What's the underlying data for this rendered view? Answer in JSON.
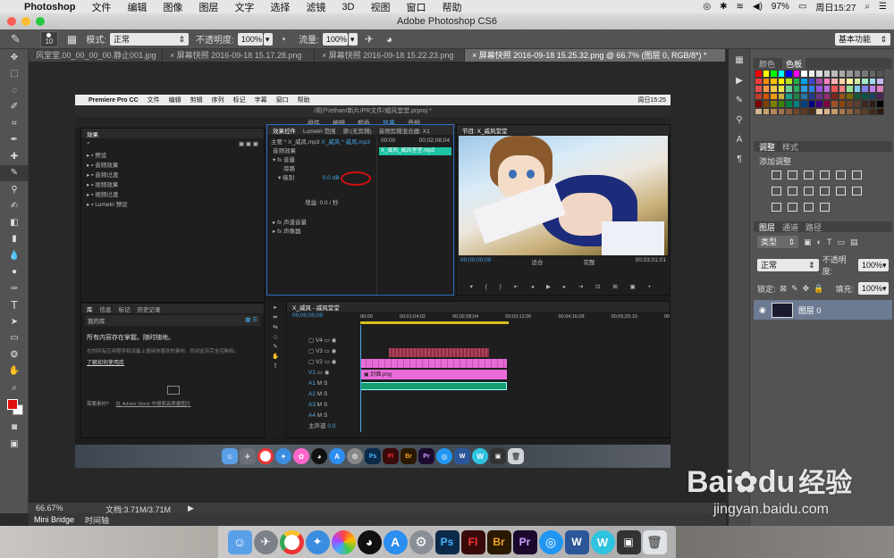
{
  "menubar": {
    "apple": "",
    "app": "Photoshop",
    "items": [
      "文件",
      "编辑",
      "图像",
      "图层",
      "文字",
      "选择",
      "滤镜",
      "3D",
      "视图",
      "窗口",
      "帮助"
    ],
    "battery": "97%",
    "clock": "周日15:27"
  },
  "window": {
    "title": "Adobe Photoshop CS6"
  },
  "options": {
    "brush_size": "10",
    "mode_label": "模式:",
    "mode_value": "正常",
    "opacity_label": "不透明度:",
    "opacity_value": "100%",
    "flow_label": "流量:",
    "flow_value": "100%",
    "workspace": "基本功能"
  },
  "tabs": [
    {
      "label": "风堂堂.00_00_00_00.静止001.jpg",
      "active": false
    },
    {
      "label": "屏幕快照 2016-09-18 15.17.28.png",
      "active": false
    },
    {
      "label": "屏幕快照 2016-09-18 15.22.23.png",
      "active": false
    },
    {
      "label": "屏幕快照 2016-09-18 15.25.32.png @ 66.7% (图层 0, RGB/8*) *",
      "active": true
    }
  ],
  "status": {
    "zoom": "66.67%",
    "doc": "文档:3.71M/3.71M"
  },
  "bottom_tabs": [
    "Mini Bridge",
    "时间轴"
  ],
  "premiere": {
    "app": "Premiere Pro CC",
    "menu": [
      "文件",
      "编辑",
      "剪辑",
      "序列",
      "标记",
      "字幕",
      "窗口",
      "帮助"
    ],
    "clock": "周日15:25",
    "path": "/用户/ethan/新片/PR文件/威风堂堂.prproj *",
    "workspace": [
      "组件",
      "编辑",
      "颜色",
      "效果",
      "音频",
      "图形"
    ],
    "effects_panel": {
      "tabs": [
        "效果",
        "Lumetri 范围",
        "源:(无剪辑)",
        "音频剪辑混合器: X1"
      ],
      "items": [
        "预设",
        "音频效果",
        "音频过渡",
        "视频效果",
        "视频过渡",
        "Lumetri 预设"
      ]
    },
    "effect_controls": {
      "tab": "效果控件",
      "source": "主要 * X_威风.mp3",
      "sequence": "X_威风 * 威风.mp3",
      "clip": "X_威风_威风堂堂.mp3",
      "rows": [
        "音频效果",
        "fx 音量",
        "旁路",
        "级别",
        "fx 声道音量",
        "fx 声像器"
      ],
      "level_value": "0.0 dB",
      "time1": "00:00",
      "time2": "00;02;08;04",
      "gain": "增益: 0.0 / 秒"
    },
    "program": {
      "title": "节目: X_威风堂堂",
      "timecode": "00;00;00;00",
      "fit": "适合",
      "quality": "完整",
      "duration": "00;03;01;01"
    },
    "library": {
      "tabs": [
        "库",
        "信息",
        "标记",
        "历史记录"
      ],
      "sel": "我的库",
      "msg": "所有内容存在掌握。随时随地。",
      "sub": "在你所有应用程序和设备上使用你喜欢的素材。你对此有完全控制权。",
      "link": "了解如何使用库",
      "stock_a": "需要素材?",
      "stock_b": "在 Adobe Stock 中搜索高质量图片"
    },
    "timeline": {
      "title": "X_威风 - 威风堂堂",
      "timecode": "00;00;00;00",
      "ruler": [
        "00;00",
        "00;01;04;02",
        "00;02;08;04",
        "00;03;12;06",
        "00;04;16;08",
        "00;05;20;10",
        "00"
      ],
      "tracks": [
        "V4",
        "V3",
        "V2",
        "V1",
        "A1",
        "A2",
        "A3",
        "A4"
      ],
      "master": "主声道",
      "master_val": "0.0",
      "clip_label": "封面.png"
    }
  },
  "right_panel": {
    "color_tabs": [
      "颜色",
      "色板"
    ],
    "adj_tabs": [
      "调整",
      "样式"
    ],
    "adj_title": "添加调整",
    "layer_tabs": [
      "图层",
      "通道",
      "路径"
    ],
    "kind": "类型",
    "blend": "正常",
    "opacity_label": "不透明度:",
    "opacity": "100%",
    "lock_label": "锁定:",
    "fill_label": "填充:",
    "fill": "100%",
    "layer_name": "图层 0"
  },
  "watermark": {
    "brand": "Bai",
    "mid": "du",
    "cn": "经验",
    "url": "jingyan.baidu.com"
  },
  "colors": {
    "accent": "#2d6fc4",
    "fg": "#e01010",
    "bg": "#ffffff",
    "selection_red": "#d41010"
  }
}
